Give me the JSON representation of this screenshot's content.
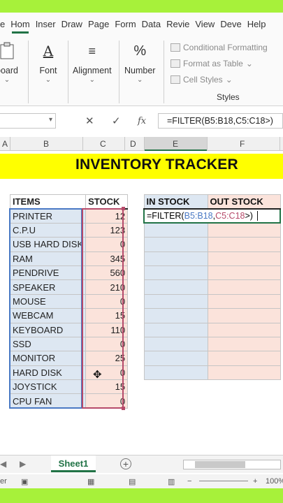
{
  "ribbon": {
    "tabs": [
      "e",
      "Hom",
      "Inser",
      "Draw",
      "Page",
      "Form",
      "Data",
      "Revie",
      "View",
      "Deve",
      "Help"
    ],
    "active_tab": "Hom",
    "groups": {
      "clipboard": "board",
      "font": "Font",
      "alignment": "Alignment",
      "number": "Number",
      "number_symbol": "%"
    },
    "styles": {
      "conditional": "Conditional Formatting",
      "format_table": "Format as Table",
      "cell_styles": "Cell Styles",
      "group_label": "Styles"
    }
  },
  "formula_bar": {
    "cancel": "✕",
    "enter": "✓",
    "fx": "fx",
    "content": "=FILTER(B5:B18,C5:C18>)"
  },
  "columns": [
    "A",
    "B",
    "C",
    "D",
    "E",
    "F"
  ],
  "title": "INVENTORY TRACKER",
  "inventory": {
    "headers": [
      "ITEMS",
      "STOCK"
    ],
    "rows": [
      [
        "PRINTER",
        "12"
      ],
      [
        "C.P.U",
        "123"
      ],
      [
        "USB HARD DISK",
        "0"
      ],
      [
        "RAM",
        "345"
      ],
      [
        "PENDRIVE",
        "560"
      ],
      [
        "SPEAKER",
        "210"
      ],
      [
        "MOUSE",
        "0"
      ],
      [
        "WEBCAM",
        "15"
      ],
      [
        "KEYBOARD",
        "110"
      ],
      [
        "SSD",
        "0"
      ],
      [
        "MONITOR",
        "25"
      ],
      [
        "HARD DISK",
        "0"
      ],
      [
        "JOYSTICK",
        "15"
      ],
      [
        "CPU FAN",
        "0"
      ]
    ]
  },
  "output": {
    "headers": [
      "IN STOCK",
      "OUT STOCK"
    ],
    "editing_prefix": "=FILTER(",
    "editing_ref1": "B5:B18",
    "editing_comma": ",",
    "editing_ref2": "C5:C18",
    "editing_suffix": ">)",
    "empty_rows": 11
  },
  "sheets": {
    "active": "Sheet1"
  },
  "status": {
    "left": "er",
    "zoom": "100%"
  },
  "colors": {
    "frame": "#a7f13a",
    "title_band": "#ffff00",
    "excel_green": "#217346",
    "items_fill": "#dde7f2",
    "stock_fill": "#fbe3db"
  }
}
